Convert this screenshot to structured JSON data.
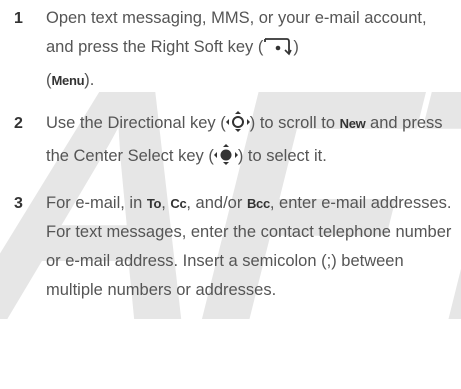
{
  "watermark": "AFT",
  "steps": [
    {
      "number": "1",
      "part1": "Open text messaging, MMS, or your e-mail account, and press the Right Soft key (",
      "icon": "right-soft-key-icon",
      "part2": ")",
      "term": "Menu",
      "part3": "."
    },
    {
      "number": "2",
      "part1": "Use the Directional key (",
      "icon1": "directional-key-icon",
      "part2": ") to scroll to ",
      "term": "New",
      "part3": " and press the Center Select key (",
      "icon2": "center-select-key-icon",
      "part4": ") to select it."
    },
    {
      "number": "3",
      "part1": "For e-mail, in ",
      "term1": "To",
      "sep1": ", ",
      "term2": "Cc",
      "sep2": ", and/or ",
      "term3": "Bcc",
      "part2": ", enter e-mail addresses. For text messages, enter the contact telephone number or e-mail address. Insert a semicolon (;) between multiple numbers or addresses."
    }
  ]
}
